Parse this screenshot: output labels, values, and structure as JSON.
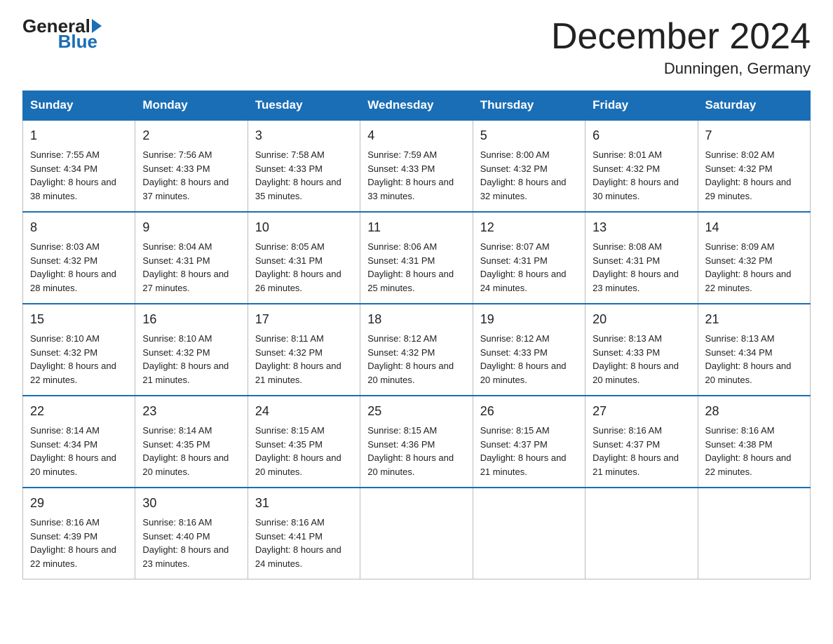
{
  "logo": {
    "general": "General",
    "blue": "Blue"
  },
  "title": {
    "month_year": "December 2024",
    "location": "Dunningen, Germany"
  },
  "header_days": [
    "Sunday",
    "Monday",
    "Tuesday",
    "Wednesday",
    "Thursday",
    "Friday",
    "Saturday"
  ],
  "weeks": [
    [
      {
        "day": "1",
        "sunrise": "7:55 AM",
        "sunset": "4:34 PM",
        "daylight": "8 hours and 38 minutes."
      },
      {
        "day": "2",
        "sunrise": "7:56 AM",
        "sunset": "4:33 PM",
        "daylight": "8 hours and 37 minutes."
      },
      {
        "day": "3",
        "sunrise": "7:58 AM",
        "sunset": "4:33 PM",
        "daylight": "8 hours and 35 minutes."
      },
      {
        "day": "4",
        "sunrise": "7:59 AM",
        "sunset": "4:33 PM",
        "daylight": "8 hours and 33 minutes."
      },
      {
        "day": "5",
        "sunrise": "8:00 AM",
        "sunset": "4:32 PM",
        "daylight": "8 hours and 32 minutes."
      },
      {
        "day": "6",
        "sunrise": "8:01 AM",
        "sunset": "4:32 PM",
        "daylight": "8 hours and 30 minutes."
      },
      {
        "day": "7",
        "sunrise": "8:02 AM",
        "sunset": "4:32 PM",
        "daylight": "8 hours and 29 minutes."
      }
    ],
    [
      {
        "day": "8",
        "sunrise": "8:03 AM",
        "sunset": "4:32 PM",
        "daylight": "8 hours and 28 minutes."
      },
      {
        "day": "9",
        "sunrise": "8:04 AM",
        "sunset": "4:31 PM",
        "daylight": "8 hours and 27 minutes."
      },
      {
        "day": "10",
        "sunrise": "8:05 AM",
        "sunset": "4:31 PM",
        "daylight": "8 hours and 26 minutes."
      },
      {
        "day": "11",
        "sunrise": "8:06 AM",
        "sunset": "4:31 PM",
        "daylight": "8 hours and 25 minutes."
      },
      {
        "day": "12",
        "sunrise": "8:07 AM",
        "sunset": "4:31 PM",
        "daylight": "8 hours and 24 minutes."
      },
      {
        "day": "13",
        "sunrise": "8:08 AM",
        "sunset": "4:31 PM",
        "daylight": "8 hours and 23 minutes."
      },
      {
        "day": "14",
        "sunrise": "8:09 AM",
        "sunset": "4:32 PM",
        "daylight": "8 hours and 22 minutes."
      }
    ],
    [
      {
        "day": "15",
        "sunrise": "8:10 AM",
        "sunset": "4:32 PM",
        "daylight": "8 hours and 22 minutes."
      },
      {
        "day": "16",
        "sunrise": "8:10 AM",
        "sunset": "4:32 PM",
        "daylight": "8 hours and 21 minutes."
      },
      {
        "day": "17",
        "sunrise": "8:11 AM",
        "sunset": "4:32 PM",
        "daylight": "8 hours and 21 minutes."
      },
      {
        "day": "18",
        "sunrise": "8:12 AM",
        "sunset": "4:32 PM",
        "daylight": "8 hours and 20 minutes."
      },
      {
        "day": "19",
        "sunrise": "8:12 AM",
        "sunset": "4:33 PM",
        "daylight": "8 hours and 20 minutes."
      },
      {
        "day": "20",
        "sunrise": "8:13 AM",
        "sunset": "4:33 PM",
        "daylight": "8 hours and 20 minutes."
      },
      {
        "day": "21",
        "sunrise": "8:13 AM",
        "sunset": "4:34 PM",
        "daylight": "8 hours and 20 minutes."
      }
    ],
    [
      {
        "day": "22",
        "sunrise": "8:14 AM",
        "sunset": "4:34 PM",
        "daylight": "8 hours and 20 minutes."
      },
      {
        "day": "23",
        "sunrise": "8:14 AM",
        "sunset": "4:35 PM",
        "daylight": "8 hours and 20 minutes."
      },
      {
        "day": "24",
        "sunrise": "8:15 AM",
        "sunset": "4:35 PM",
        "daylight": "8 hours and 20 minutes."
      },
      {
        "day": "25",
        "sunrise": "8:15 AM",
        "sunset": "4:36 PM",
        "daylight": "8 hours and 20 minutes."
      },
      {
        "day": "26",
        "sunrise": "8:15 AM",
        "sunset": "4:37 PM",
        "daylight": "8 hours and 21 minutes."
      },
      {
        "day": "27",
        "sunrise": "8:16 AM",
        "sunset": "4:37 PM",
        "daylight": "8 hours and 21 minutes."
      },
      {
        "day": "28",
        "sunrise": "8:16 AM",
        "sunset": "4:38 PM",
        "daylight": "8 hours and 22 minutes."
      }
    ],
    [
      {
        "day": "29",
        "sunrise": "8:16 AM",
        "sunset": "4:39 PM",
        "daylight": "8 hours and 22 minutes."
      },
      {
        "day": "30",
        "sunrise": "8:16 AM",
        "sunset": "4:40 PM",
        "daylight": "8 hours and 23 minutes."
      },
      {
        "day": "31",
        "sunrise": "8:16 AM",
        "sunset": "4:41 PM",
        "daylight": "8 hours and 24 minutes."
      },
      null,
      null,
      null,
      null
    ]
  ],
  "labels": {
    "sunrise": "Sunrise:",
    "sunset": "Sunset:",
    "daylight": "Daylight:"
  }
}
